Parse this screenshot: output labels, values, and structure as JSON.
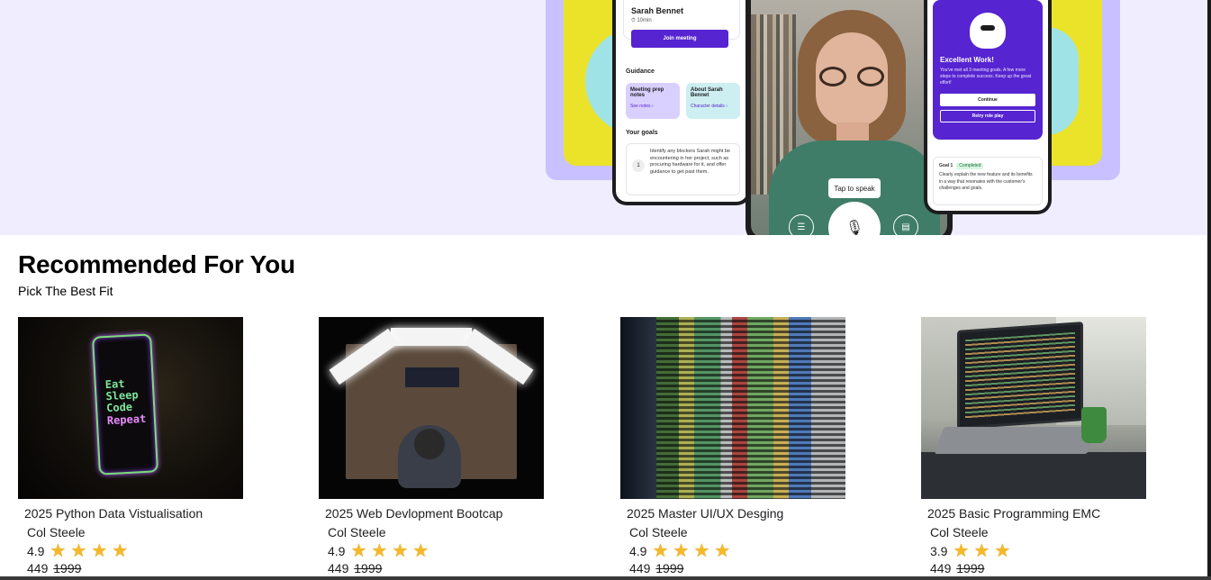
{
  "hero": {
    "left_phone": {
      "name": "Sarah Bennet",
      "time": "⏱ 10min",
      "join_label": "Join meeting",
      "guidance_heading": "Guidance",
      "guidance_1_title": "Meeting prep notes",
      "guidance_1_link": "See notes ›",
      "guidance_2_title": "About Sarah Bennet",
      "guidance_2_link": "Character details ›",
      "goals_heading": "Your goals",
      "goal_number": "1",
      "goal_text": "Identify any blockers Sarah might be encountering in her project, such as procuring hardware for it, and offer guidance to get past them."
    },
    "middle_phone": {
      "tap_label": "Tap to speak"
    },
    "right_phone": {
      "title": "Excellent Work!",
      "description": "You've met all 3 meeting goals. A few more steps to complete success. Keep up the great effort!",
      "continue_label": "Continue",
      "retry_label": "Retry role play",
      "goal_label": "Goal 1",
      "goal_badge": "Completed",
      "goal_text": "Clearly explain the new feature and its benefits in a way that resonates with the customer's challenges and goals."
    }
  },
  "section": {
    "title": "Recommended For You",
    "subtitle": "Pick The Best Fit"
  },
  "courses": [
    {
      "title": "2025 Python Data Vistualisation",
      "author": "Col Steele",
      "rating": "4.9",
      "stars": 4,
      "price": "449",
      "old_price": "1999",
      "thumb_text": [
        "Eat",
        "Sleep",
        "Code",
        "Repeat"
      ]
    },
    {
      "title": "2025 Web Devlopment Bootcap",
      "author": "Col Steele",
      "rating": "4.9",
      "stars": 4,
      "price": "449",
      "old_price": "1999"
    },
    {
      "title": "2025 Master UI/UX Desging",
      "author": "Col Steele",
      "rating": "4.9",
      "stars": 4,
      "price": "449",
      "old_price": "1999"
    },
    {
      "title": "2025 Basic Programming EMC",
      "author": "Col Steele",
      "rating": "3.9",
      "stars": 3,
      "price": "449",
      "old_price": "1999"
    }
  ],
  "colors": {
    "accent": "#5624d0",
    "hero_bg": "#efedff",
    "star": "#f5b928"
  },
  "icons": {
    "star": "star-icon",
    "mic": "microphone-icon",
    "chat": "chat-icon",
    "notes": "notes-icon"
  }
}
